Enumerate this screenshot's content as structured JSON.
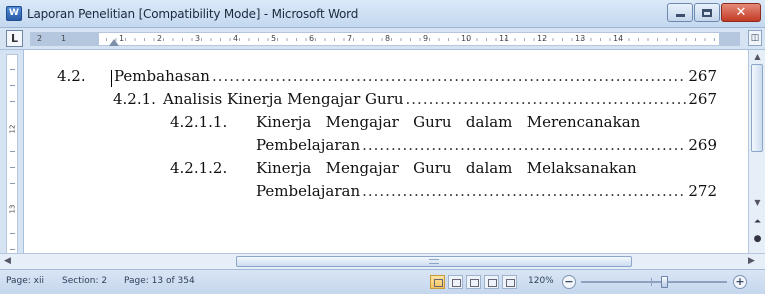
{
  "window": {
    "app_icon_glyph": "W",
    "title": "Laporan Penelitian [Compatibility Mode] - Microsoft Word",
    "close_glyph": "✕"
  },
  "ruler": {
    "tab_selector": "L",
    "numbers": [
      "2",
      "1",
      "1",
      "2",
      "3",
      "4",
      "5",
      "6",
      "7",
      "8",
      "9",
      "10",
      "11",
      "12",
      "13",
      "14"
    ],
    "view_ruler_glyph": "◫"
  },
  "vertical_ruler": {
    "numbers": [
      "12",
      "13"
    ]
  },
  "document": {
    "toc": [
      {
        "number": "4.2.",
        "title": "Pembahasan",
        "page": "267"
      },
      {
        "number": "4.2.1.",
        "title": "Analisis Kinerja Mengajar Guru",
        "page": "267"
      },
      {
        "number": "4.2.1.1.",
        "title": "Kinerja   Mengajar   Guru   dalam   Merencanakan",
        "continuation": "Pembelajaran",
        "page": "269"
      },
      {
        "number": "4.2.1.2.",
        "title": "Kinerja   Mengajar   Guru   dalam   Melaksanakan",
        "continuation": "Pembelajaran",
        "page": "272"
      }
    ]
  },
  "scrollbars": {
    "up": "▲",
    "down": "▼",
    "left": "◀",
    "right": "▶",
    "prev_page": "⏶",
    "select_object": "●",
    "next_page": "⏷"
  },
  "statusbar": {
    "page_section": "Page: xii",
    "section": "Section: 2",
    "page_of": "Page: 13 of 354",
    "zoom_level": "120%",
    "zoom_minus": "−",
    "zoom_plus": "+",
    "zoom_fraction": 0.55
  },
  "colors": {
    "titlebar": "#c3d8ef",
    "chrome": "#d6e3f3",
    "close_button": "#c33b24"
  }
}
